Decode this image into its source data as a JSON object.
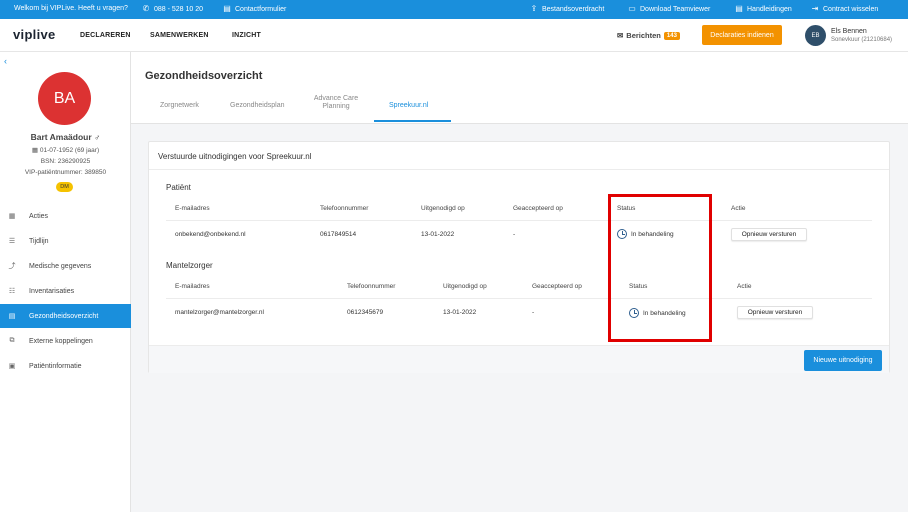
{
  "topbar": {
    "welcome": "Welkom bij VIPLive. Heeft u vragen?",
    "phone": "088 - 528 10 20",
    "contact": "Contactformulier",
    "transfer": "Bestandsoverdracht",
    "teamviewer": "Download Teamviewer",
    "manuals": "Handleidingen",
    "switch": "Contract wisselen"
  },
  "nav": {
    "logo": "viplive",
    "links": [
      "DECLAREREN",
      "SAMENWERKEN",
      "INZICHT"
    ],
    "messages_label": "Berichten",
    "messages_count": "143",
    "submit_button": "Declaraties indienen",
    "user_initials": "EB",
    "user_name": "Els Bennen",
    "user_role": "Sonevkuur (21210684)"
  },
  "patient": {
    "initials": "BA",
    "name": "Bart Amaädour ♂",
    "dob": "01-07-1952 (69 jaar)",
    "bsn": "BSN: 236290925",
    "vip": "VIP-patiëntnummer: 389850",
    "badge": "DM"
  },
  "sidebar": {
    "items": [
      {
        "label": "Acties",
        "icon": "calendar-icon"
      },
      {
        "label": "Tijdlijn",
        "icon": "list-icon"
      },
      {
        "label": "Medische gegevens",
        "icon": "chart-icon"
      },
      {
        "label": "Inventarisaties",
        "icon": "checklist-icon"
      },
      {
        "label": "Gezondheidsoverzicht",
        "icon": "document-icon"
      },
      {
        "label": "Externe koppelingen",
        "icon": "external-link-icon"
      },
      {
        "label": "Patiëntinformatie",
        "icon": "id-card-icon"
      }
    ],
    "active_index": 4
  },
  "page": {
    "title": "Gezondheidsoverzicht",
    "tabs": [
      "Zorgnetwerk",
      "Gezondheidsplan",
      "Advance Care",
      "Planning",
      "Spreekuur.nl"
    ]
  },
  "card": {
    "title": "Verstuurde uitnodigingen voor Spreekuur.nl",
    "patient_section": {
      "title": "Patiënt",
      "headers": [
        "E-mailadres",
        "Telefoonnummer",
        "Uitgenodigd op",
        "Geaccepteerd op",
        "Status",
        "Actie"
      ],
      "row": {
        "email": "onbekend@onbekend.nl",
        "phone": "0617849514",
        "invited": "13-01-2022",
        "accepted": "-",
        "status": "In behandeling",
        "action": "Opnieuw versturen"
      }
    },
    "carer_section": {
      "title": "Mantelzorger",
      "headers": [
        "E-mailadres",
        "Telefoonnummer",
        "Uitgenodigd op",
        "Geaccepteerd op",
        "Status",
        "Actie"
      ],
      "row": {
        "email": "mantelzorger@mantelzorger.nl",
        "phone": "0612345679",
        "invited": "13-01-2022",
        "accepted": "-",
        "status": "In behandeling",
        "action": "Opnieuw versturen"
      }
    },
    "new_invite": "Nieuwe uitnodiging"
  },
  "colors": {
    "brand_blue": "#1a8fdc",
    "orange": "#f39200",
    "highlight_red": "#e00000",
    "avatar_red": "#dc3232"
  }
}
